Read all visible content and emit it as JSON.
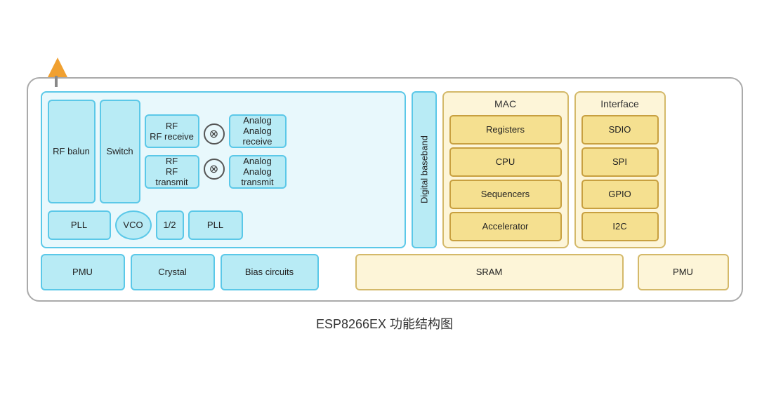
{
  "diagram": {
    "title": "ESP8266EX 功能结构图",
    "antenna_label": "antenna",
    "blocks": {
      "rf_balun": "RF balun",
      "switch": "Switch",
      "rf_receive": "RF\nreceive",
      "rf_transmit": "RF\ntransmit",
      "analog_receive": "Analog\nreceive",
      "analog_transmit": "Analog\ntransmit",
      "pll_left": "PLL",
      "vco": "VCO",
      "half": "1/2",
      "pll_right": "PLL",
      "digital_baseband": "Digital baseband",
      "mac_title": "MAC",
      "registers": "Registers",
      "cpu": "CPU",
      "sequencers": "Sequencers",
      "accelerator": "Accelerator",
      "interface_title": "Interface",
      "sdio": "SDIO",
      "spi": "SPI",
      "gpio": "GPIO",
      "i2c": "I2C",
      "pmu_left": "PMU",
      "crystal": "Crystal",
      "bias_circuits": "Bias circuits",
      "sram": "SRAM",
      "pmu_right": "PMU"
    }
  }
}
